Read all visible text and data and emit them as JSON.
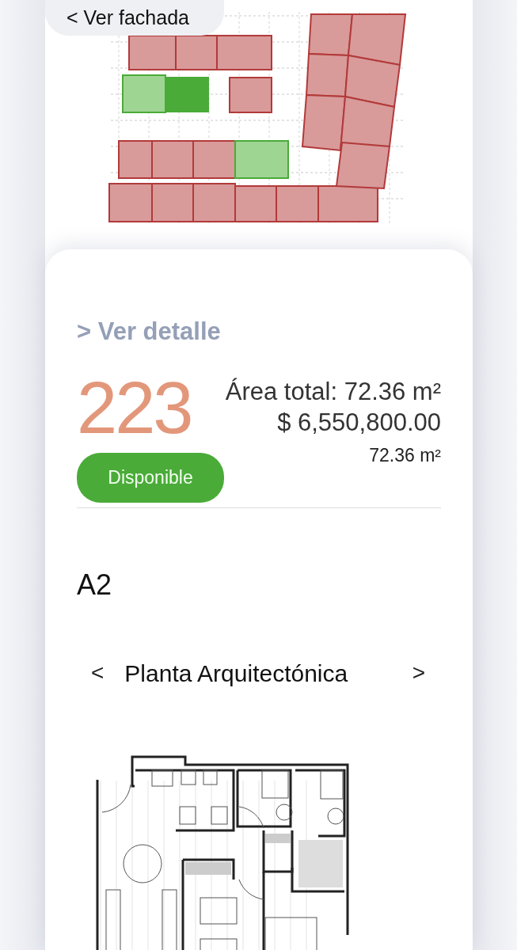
{
  "back_link": {
    "label": "< Ver fachada"
  },
  "unit": {
    "detail_link": "> Ver detalle",
    "number": "223",
    "area_total": "Área total: 72.36 m²",
    "price": "$ 6,550,800.00",
    "status": {
      "label": "Disponible",
      "available": true
    },
    "area": "72.36 m²"
  },
  "model": {
    "name": "A2"
  },
  "carousel": {
    "prev": "<",
    "title": "Planta Arquitectónica",
    "next": ">"
  }
}
